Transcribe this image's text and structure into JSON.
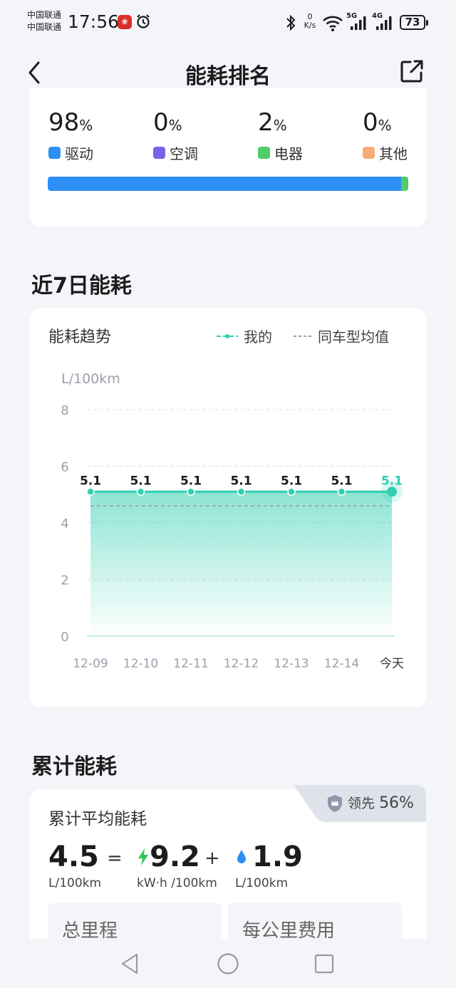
{
  "status": {
    "carrier1": "中国联通",
    "carrier2": "中国联通",
    "time": "17:56",
    "app_badge": "华为",
    "netspeed_value": "0",
    "netspeed_unit": "K/s",
    "net5g": "5G",
    "net4g": "4G",
    "battery": "73"
  },
  "nav": {
    "title": "能耗排名"
  },
  "distribution": {
    "items": [
      {
        "value": "98",
        "unit": "%",
        "label": "驱动",
        "color": "#2d8ff5"
      },
      {
        "value": "0",
        "unit": "%",
        "label": "空调",
        "color": "#7b61e8"
      },
      {
        "value": "2",
        "unit": "%",
        "label": "电器",
        "color": "#4fcc6a"
      },
      {
        "value": "0",
        "unit": "%",
        "label": "其他",
        "color": "#f7ad7a"
      }
    ]
  },
  "week_section": {
    "title": "近7日能耗"
  },
  "trend": {
    "title": "能耗趋势",
    "legend_mine": "我的",
    "legend_avg": "同车型均值"
  },
  "chart_data": {
    "type": "area",
    "ylabel": "L/100km",
    "ylim": [
      0,
      8
    ],
    "yticks": [
      0,
      2,
      4,
      6,
      8
    ],
    "categories": [
      "12-09",
      "12-10",
      "12-11",
      "12-12",
      "12-13",
      "12-14",
      "今天"
    ],
    "series": [
      {
        "name": "我的",
        "values": [
          5.1,
          5.1,
          5.1,
          5.1,
          5.1,
          5.1,
          5.1
        ],
        "labels": [
          "5.1",
          "5.1",
          "5.1",
          "5.1",
          "5.1",
          "5.1",
          "5.1"
        ],
        "color": "#2fcfb0"
      },
      {
        "name": "同车型均值",
        "values": [
          4.6,
          4.6,
          4.6,
          4.6,
          4.6,
          4.6,
          4.6
        ],
        "color": "#9aa0ab"
      }
    ],
    "grid": true
  },
  "cumulative": {
    "section_title": "累计能耗",
    "card_title": "累计平均能耗",
    "lead_prefix": "领先",
    "lead_value": "56%",
    "total_value": "4.5",
    "total_unit": "L/100km",
    "eq": "=",
    "elec_value": "9.2",
    "elec_unit": "kW·h /100km",
    "plus": "+",
    "fuel_value": "1.9",
    "fuel_unit": "L/100km",
    "tile1": "总里程",
    "tile2": "每公里费用"
  }
}
